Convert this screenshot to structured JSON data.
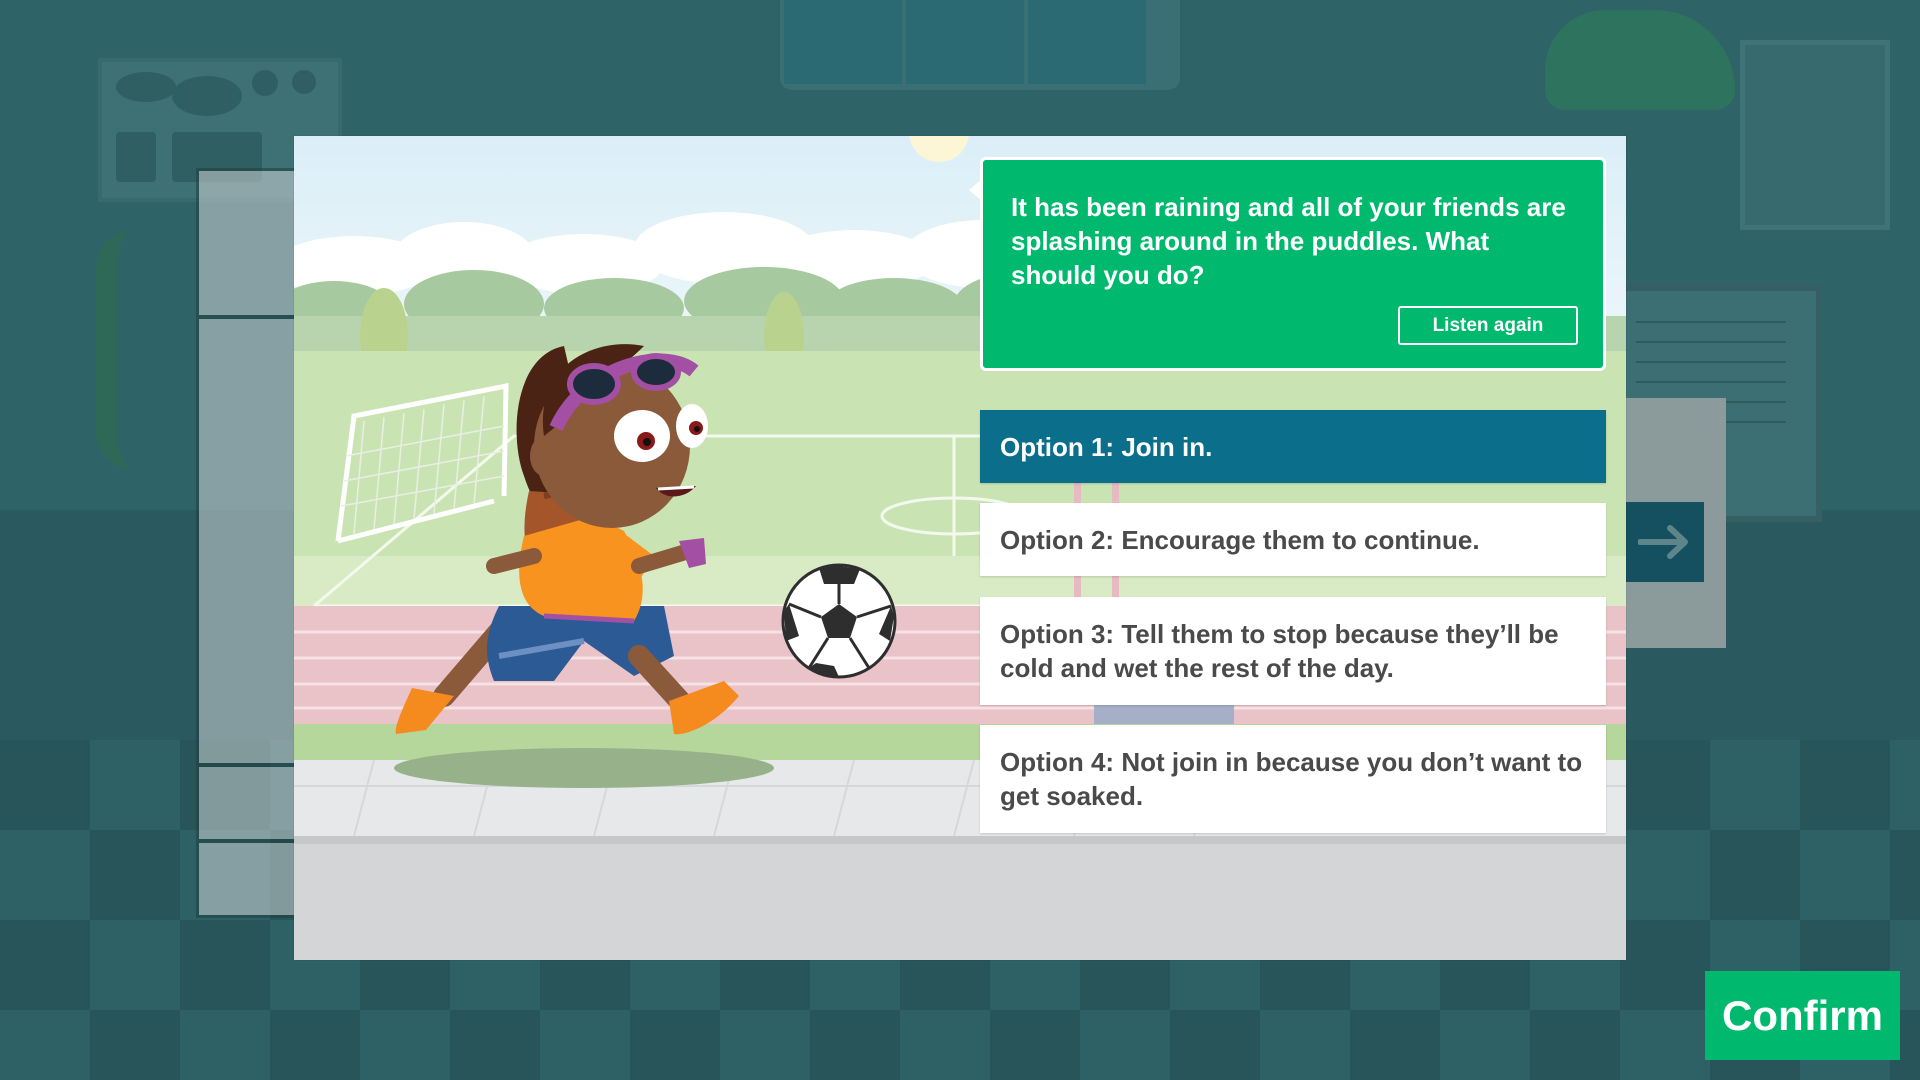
{
  "question": {
    "text": "It has been raining and all of your friends are splashing around in the puddles. What should you do?",
    "listen_label": "Listen again"
  },
  "options": [
    {
      "label": "Option 1: Join in.",
      "selected": true
    },
    {
      "label": "Option 2: Encourage them to continue.",
      "selected": false
    },
    {
      "label": "Option 3: Tell them to stop because they’ll be cold and wet the rest of the day.",
      "selected": false
    },
    {
      "label": "Option 4: Not join in because you don’t want to get soaked.",
      "selected": false
    }
  ],
  "confirm_label": "Confirm",
  "icons": {
    "next_arrow": "arrow-right-icon"
  },
  "colors": {
    "accent_green": "#00b96e",
    "selected_option": "#0b6f8c",
    "option_text": "#4a4a4a"
  }
}
